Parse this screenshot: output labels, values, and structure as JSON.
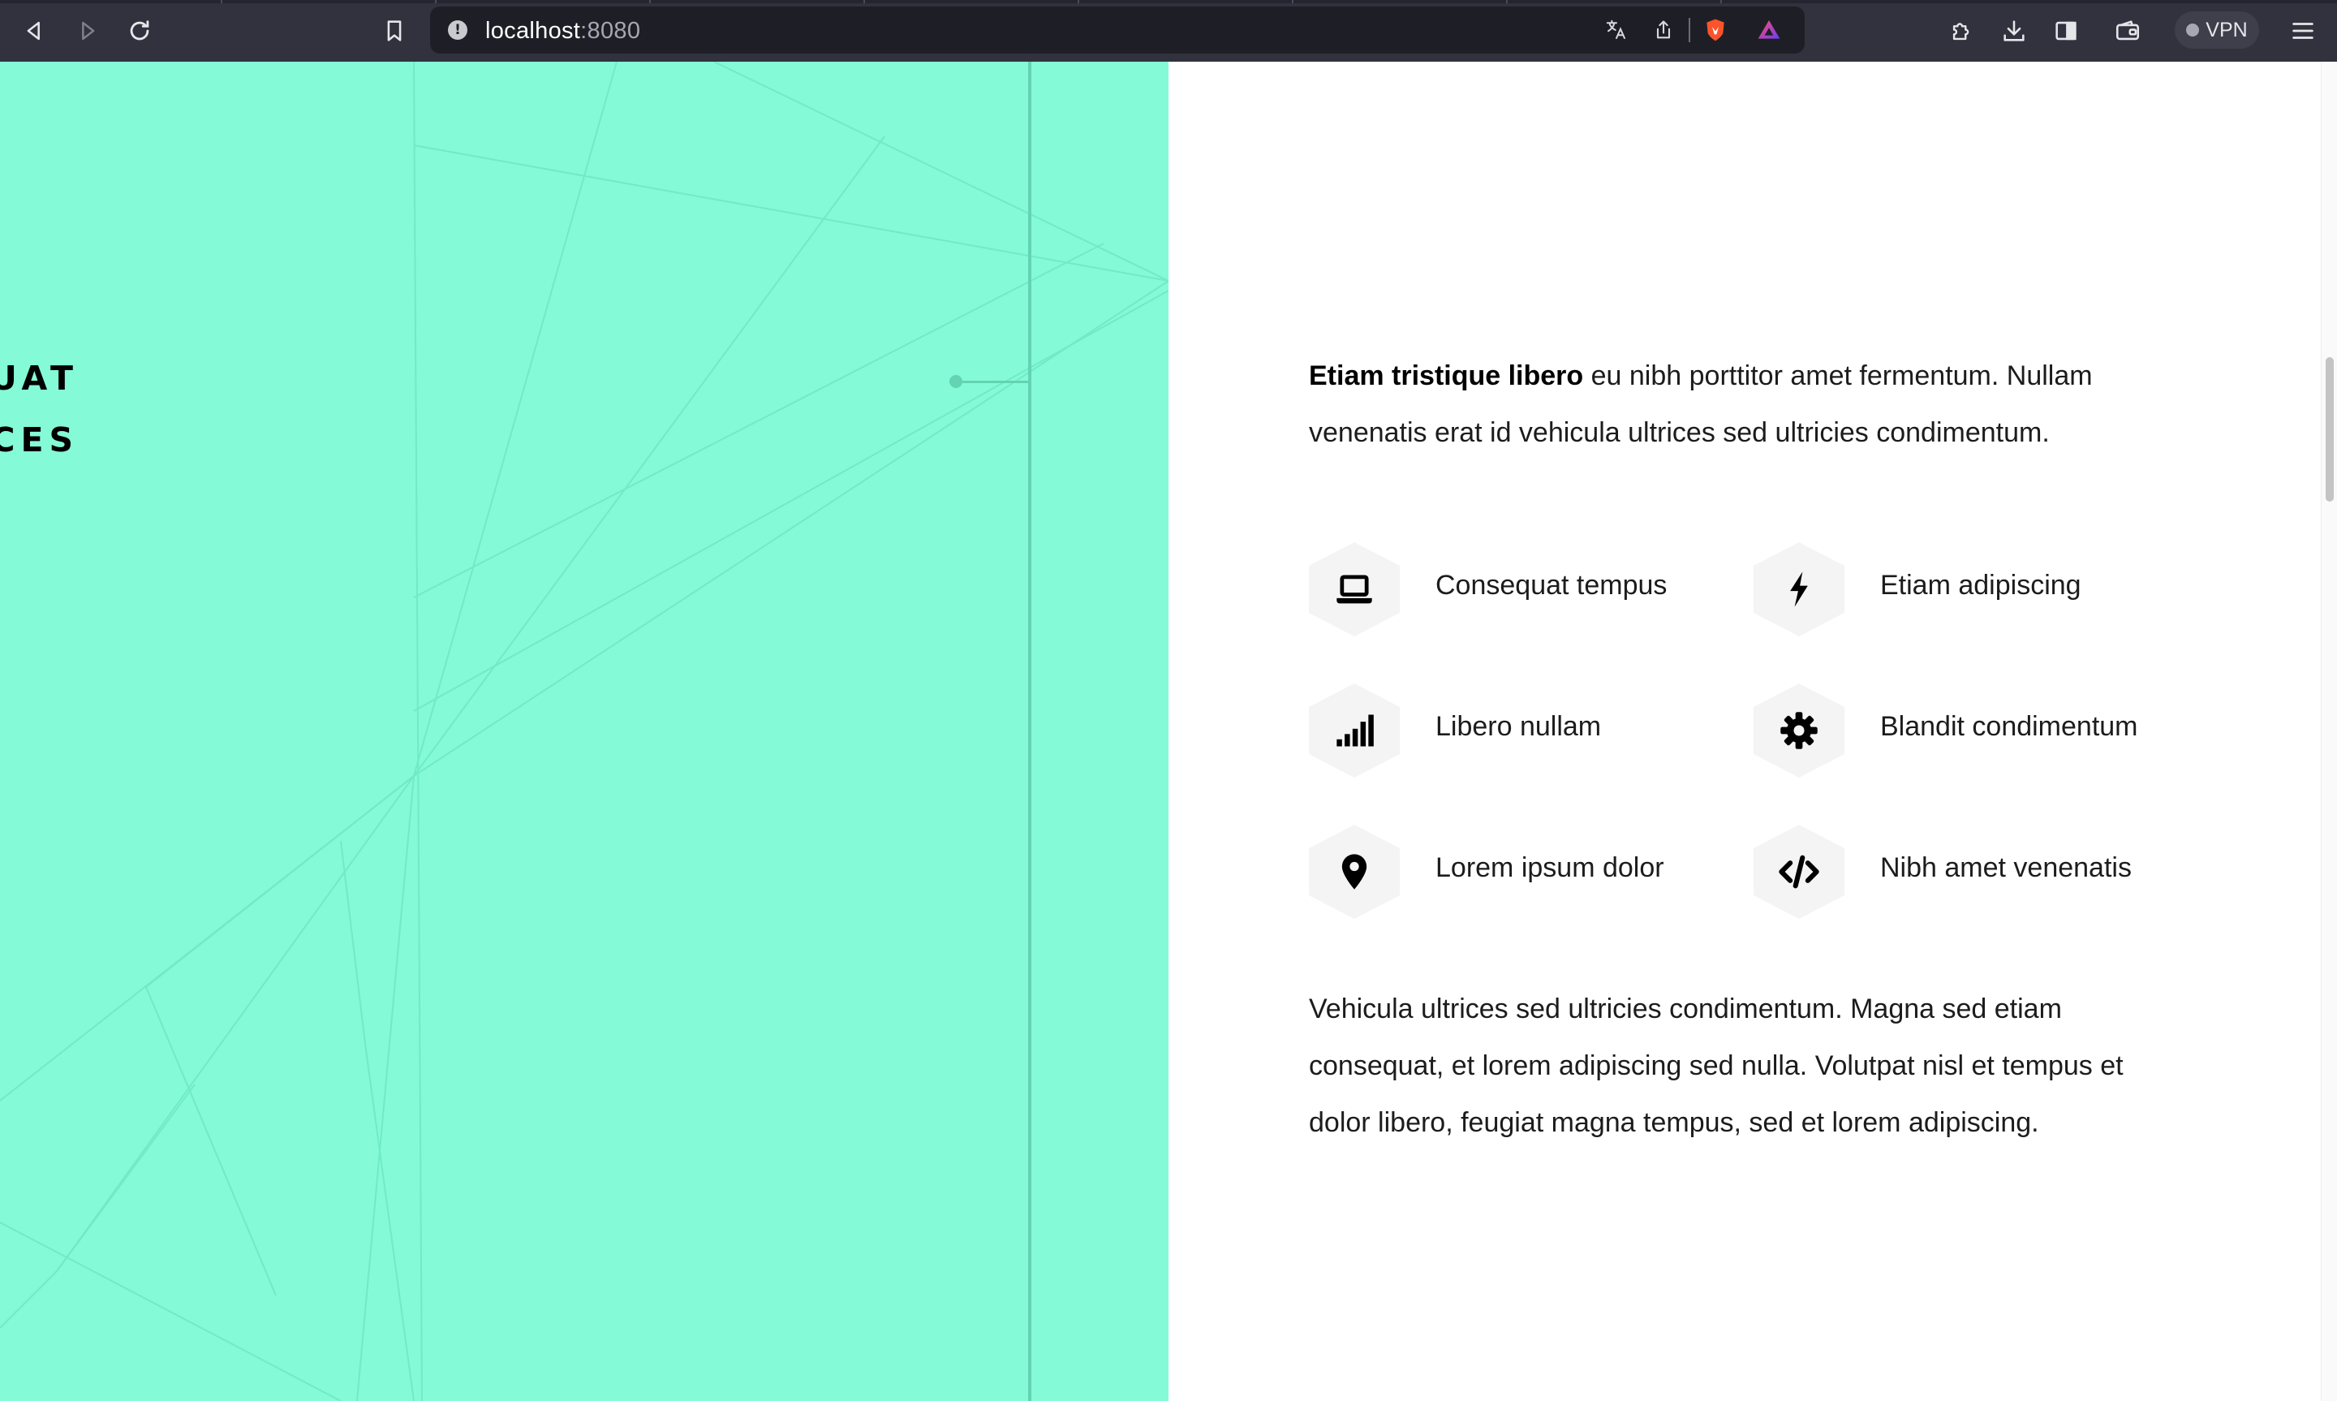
{
  "browser": {
    "url_host": "localhost",
    "url_port": ":8080",
    "vpn_label": "VPN",
    "icons": [
      "back-icon",
      "forward-icon",
      "reload-icon",
      "bookmark-icon",
      "site-info-icon",
      "translate-icon",
      "share-icon",
      "brave-shields-icon",
      "brave-rewards-icon",
      "extensions-icon",
      "downloads-icon",
      "sidebar-icon",
      "wallet-icon",
      "menu-icon"
    ]
  },
  "section": {
    "heading_line1": "FEUGIAT CONSEQUAT",
    "heading_line2": "TEMPUS ULTRICES",
    "intro_bold": "Etiam tristique libero",
    "intro_rest": " eu nibh porttitor amet fermentum. Nullam venenatis erat id vehicula ultrices sed ultricies condimentum.",
    "features": [
      {
        "label": "Consequat tempus",
        "icon": "laptop-icon"
      },
      {
        "label": "Etiam adipiscing",
        "icon": "bolt-icon"
      },
      {
        "label": "Libero nullam",
        "icon": "signal-icon"
      },
      {
        "label": "Blandit condimentum",
        "icon": "gear-icon"
      },
      {
        "label": "Lorem ipsum dolor",
        "icon": "map-marker-icon"
      },
      {
        "label": "Nibh amet venenatis",
        "icon": "code-icon"
      }
    ],
    "outro": "Vehicula ultrices sed ultricies condimentum. Magna sed etiam consequat, et lorem adipiscing sed nulla. Volutpat nisl et tempus et dolor libero, feugiat magna tempus, sed et lorem adipiscing."
  },
  "colors": {
    "accent": "#84fad6",
    "accent_line": "#63d3b3",
    "chrome_bg": "#31323d",
    "urlbar_bg": "#1e1f26"
  }
}
